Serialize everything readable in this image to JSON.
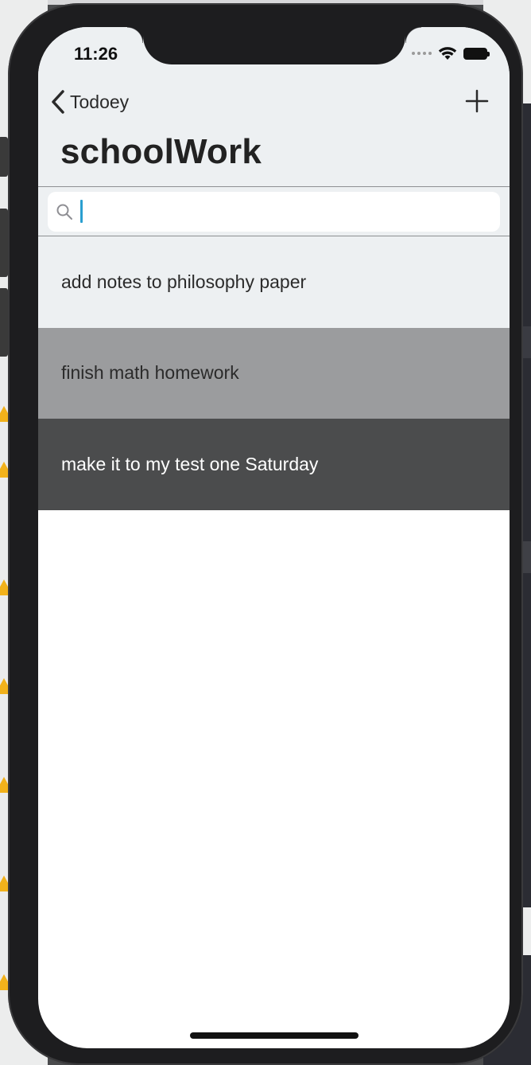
{
  "status_bar": {
    "time": "11:26"
  },
  "nav": {
    "back_label": "Todoey",
    "add_icon": "plus-icon",
    "title": "schoolWork"
  },
  "search": {
    "placeholder": "",
    "value": ""
  },
  "items": [
    {
      "title": "add notes to philosophy paper",
      "background": "#edf0f2",
      "text_color": "#2b2b2b"
    },
    {
      "title": "finish math homework",
      "background": "#9b9c9e",
      "text_color": "#2b2b2b"
    },
    {
      "title": "make it to my test one Saturday",
      "background": "#4b4c4d",
      "text_color": "#ffffff"
    }
  ],
  "colors": {
    "nav_background": "#edf0f2",
    "caret": "#2a9fd0",
    "frame": "#1d1d1f"
  }
}
